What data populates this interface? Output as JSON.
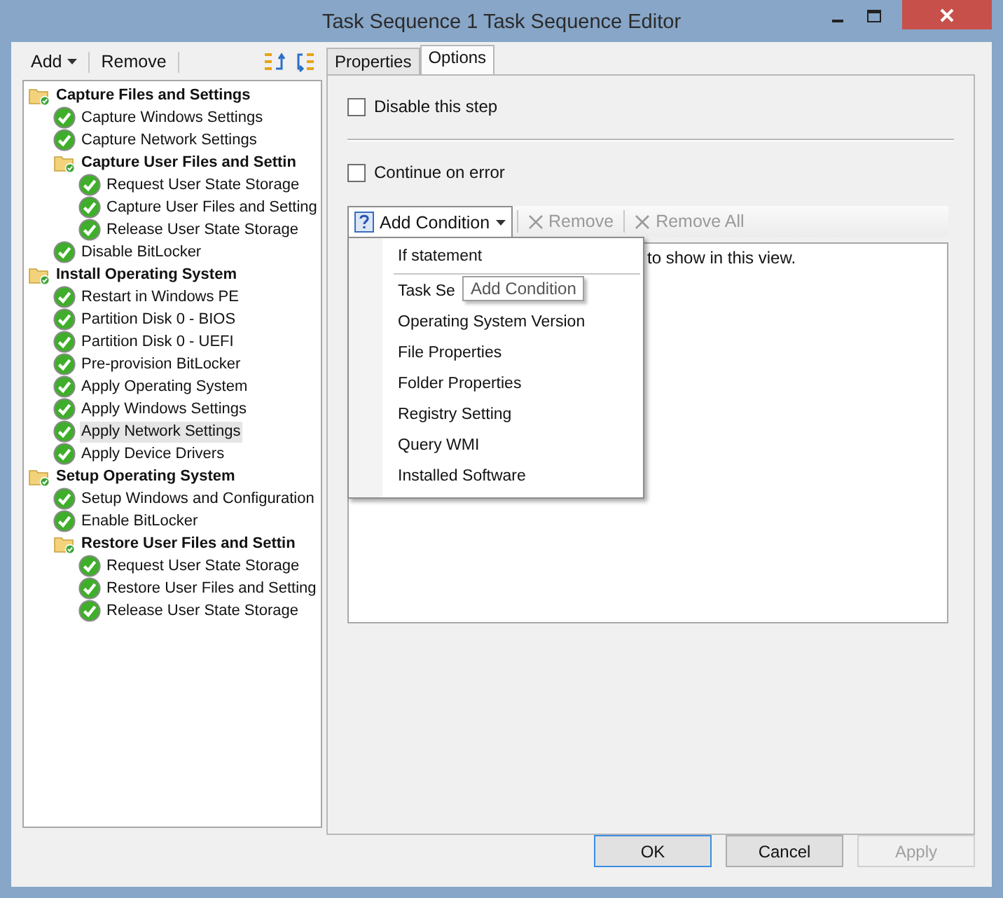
{
  "window": {
    "title": "Task Sequence 1 Task Sequence Editor"
  },
  "toolbar": {
    "add": "Add",
    "remove": "Remove"
  },
  "tree": [
    {
      "kind": "group",
      "label": "Capture Files and Settings",
      "selected": false,
      "children": [
        {
          "kind": "step",
          "label": "Capture Windows Settings",
          "selected": false
        },
        {
          "kind": "step",
          "label": "Capture Network Settings",
          "selected": false
        },
        {
          "kind": "group",
          "label": "Capture User Files and Settin",
          "selected": false,
          "children": [
            {
              "kind": "step",
              "label": "Request User State Storage",
              "selected": false
            },
            {
              "kind": "step",
              "label": "Capture User Files and Setting",
              "selected": false
            },
            {
              "kind": "step",
              "label": "Release User State Storage",
              "selected": false
            }
          ]
        },
        {
          "kind": "step",
          "label": "Disable BitLocker",
          "selected": false
        }
      ]
    },
    {
      "kind": "group",
      "label": "Install Operating System",
      "selected": false,
      "children": [
        {
          "kind": "step",
          "label": "Restart in Windows PE",
          "selected": false
        },
        {
          "kind": "step",
          "label": "Partition Disk 0 - BIOS",
          "selected": false
        },
        {
          "kind": "step",
          "label": "Partition Disk 0 - UEFI",
          "selected": false
        },
        {
          "kind": "step",
          "label": "Pre-provision BitLocker",
          "selected": false
        },
        {
          "kind": "step",
          "label": "Apply Operating System",
          "selected": false
        },
        {
          "kind": "step",
          "label": "Apply Windows Settings",
          "selected": false
        },
        {
          "kind": "step",
          "label": "Apply Network Settings",
          "selected": true
        },
        {
          "kind": "step",
          "label": "Apply Device Drivers",
          "selected": false
        }
      ]
    },
    {
      "kind": "group",
      "label": "Setup Operating System",
      "selected": false,
      "children": [
        {
          "kind": "step",
          "label": "Setup Windows and Configuration",
          "selected": false
        },
        {
          "kind": "step",
          "label": "Enable BitLocker",
          "selected": false
        },
        {
          "kind": "group",
          "label": "Restore User Files and Settin",
          "selected": false,
          "children": [
            {
              "kind": "step",
              "label": "Request User State Storage",
              "selected": false
            },
            {
              "kind": "step",
              "label": "Restore User Files and Setting",
              "selected": false
            },
            {
              "kind": "step",
              "label": "Release User State Storage",
              "selected": false
            }
          ]
        }
      ]
    }
  ],
  "tabs": [
    {
      "label": "Properties",
      "selected": false
    },
    {
      "label": "Options",
      "selected": true
    }
  ],
  "options": [
    {
      "label": "Disable this step",
      "checked": false
    },
    {
      "label": "Continue on error",
      "checked": false
    }
  ],
  "condition_toolbar": [
    {
      "kind": "add",
      "label": "Add Condition",
      "disabled": false
    },
    {
      "kind": "remove",
      "label": "Remove",
      "disabled": true
    },
    {
      "kind": "remove",
      "label": "Remove All",
      "disabled": true
    }
  ],
  "conditions_message": "to show in this view.",
  "condition_menu": [
    {
      "kind": "item",
      "label": "If statement"
    },
    {
      "kind": "separator"
    },
    {
      "kind": "item",
      "label": "Task Se"
    },
    {
      "kind": "item",
      "label": "Operating System Version"
    },
    {
      "kind": "item",
      "label": "File Properties"
    },
    {
      "kind": "item",
      "label": "Folder Properties"
    },
    {
      "kind": "item",
      "label": "Registry Setting"
    },
    {
      "kind": "item",
      "label": "Query WMI"
    },
    {
      "kind": "item",
      "label": "Installed Software"
    }
  ],
  "tooltip": "Add Condition",
  "buttons": [
    {
      "label": "OK",
      "default": true,
      "disabled": false
    },
    {
      "label": "Cancel",
      "default": false,
      "disabled": false
    },
    {
      "label": "Apply",
      "default": false,
      "disabled": true
    }
  ]
}
